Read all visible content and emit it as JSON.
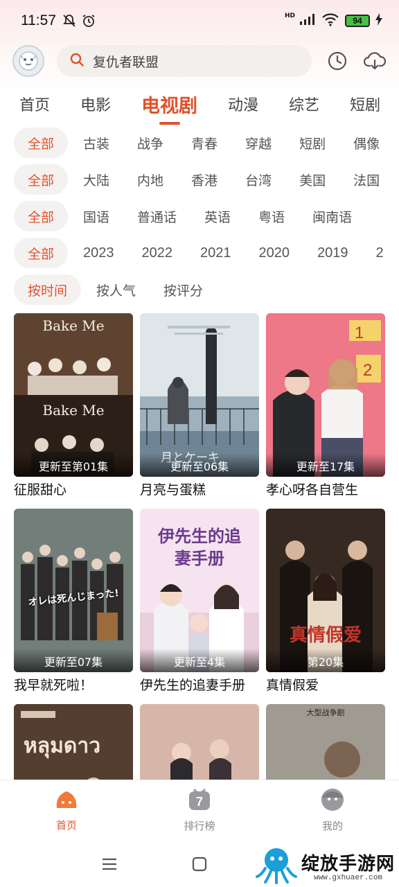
{
  "status_bar": {
    "time": "11:57",
    "hd": "HD",
    "battery": "94"
  },
  "header": {
    "search_text": "复仇者联盟"
  },
  "tabs": [
    {
      "label": "首页"
    },
    {
      "label": "电影"
    },
    {
      "label": "电视剧",
      "active": true
    },
    {
      "label": "动漫"
    },
    {
      "label": "综艺"
    },
    {
      "label": "短剧"
    }
  ],
  "filters": {
    "genre": {
      "active": "全部",
      "items": [
        "古装",
        "战争",
        "青春",
        "穿越",
        "短剧",
        "偶像"
      ]
    },
    "region": {
      "active": "全部",
      "items": [
        "大陆",
        "内地",
        "香港",
        "台湾",
        "美国",
        "法国"
      ]
    },
    "language": {
      "active": "全部",
      "items": [
        "国语",
        "普通话",
        "英语",
        "粤语",
        "闽南语"
      ]
    },
    "year": {
      "active": "全部",
      "items": [
        "2023",
        "2022",
        "2021",
        "2020",
        "2019",
        "2"
      ]
    },
    "sort": {
      "active": "按时间",
      "items": [
        "按人气",
        "按评分"
      ]
    }
  },
  "cards": [
    {
      "title": "征服甜心",
      "caption": "更新至第01集",
      "poster_text": "Bake Me",
      "colors": [
        "#2a1e17",
        "#6a4b33"
      ]
    },
    {
      "title": "月亮与蛋糕",
      "caption": "更新至06集",
      "poster_text": "月とケーキ",
      "colors": [
        "#d9e1e6",
        "#7f95a6"
      ]
    },
    {
      "title": "孝心呀各自营生",
      "caption": "更新至17集",
      "poster_text": "",
      "colors": [
        "#f07c8c",
        "#e65566"
      ]
    },
    {
      "title": "我早就死啦！",
      "caption": "更新至07集",
      "poster_text": "オレは死んじまった!",
      "colors": [
        "#7d8a86",
        "#3c4a47"
      ]
    },
    {
      "title": "伊先生的追妻手册",
      "caption": "更新至4集",
      "poster_text": "伊先生的追妻手册",
      "colors": [
        "#f4e3ee",
        "#dfb6cf"
      ]
    },
    {
      "title": "真情假爱",
      "caption": "第20集",
      "poster_text": "真情假爱",
      "colors": [
        "#3d2c24",
        "#1d1512"
      ]
    },
    {
      "title": "",
      "caption": "",
      "poster_text": "",
      "colors": [
        "#3b2a22",
        "#7a5c44"
      ]
    },
    {
      "title": "",
      "caption": "",
      "poster_text": "",
      "colors": [
        "#e9c9bf",
        "#a77b6e"
      ]
    },
    {
      "title": "",
      "caption": "",
      "poster_text": "大型战争剧",
      "colors": [
        "#cfcac0",
        "#6f6b62"
      ]
    }
  ],
  "bottom_nav": [
    {
      "label": "首页",
      "active": true,
      "icon": "home-icon"
    },
    {
      "label": "排行榜",
      "active": false,
      "icon": "ranking-icon"
    },
    {
      "label": "我的",
      "active": false,
      "icon": "profile-icon"
    }
  ],
  "watermark": {
    "text": "绽放手游网",
    "url": "www.gxhuaer.com"
  },
  "colors": {
    "accent": "#e2512b"
  }
}
